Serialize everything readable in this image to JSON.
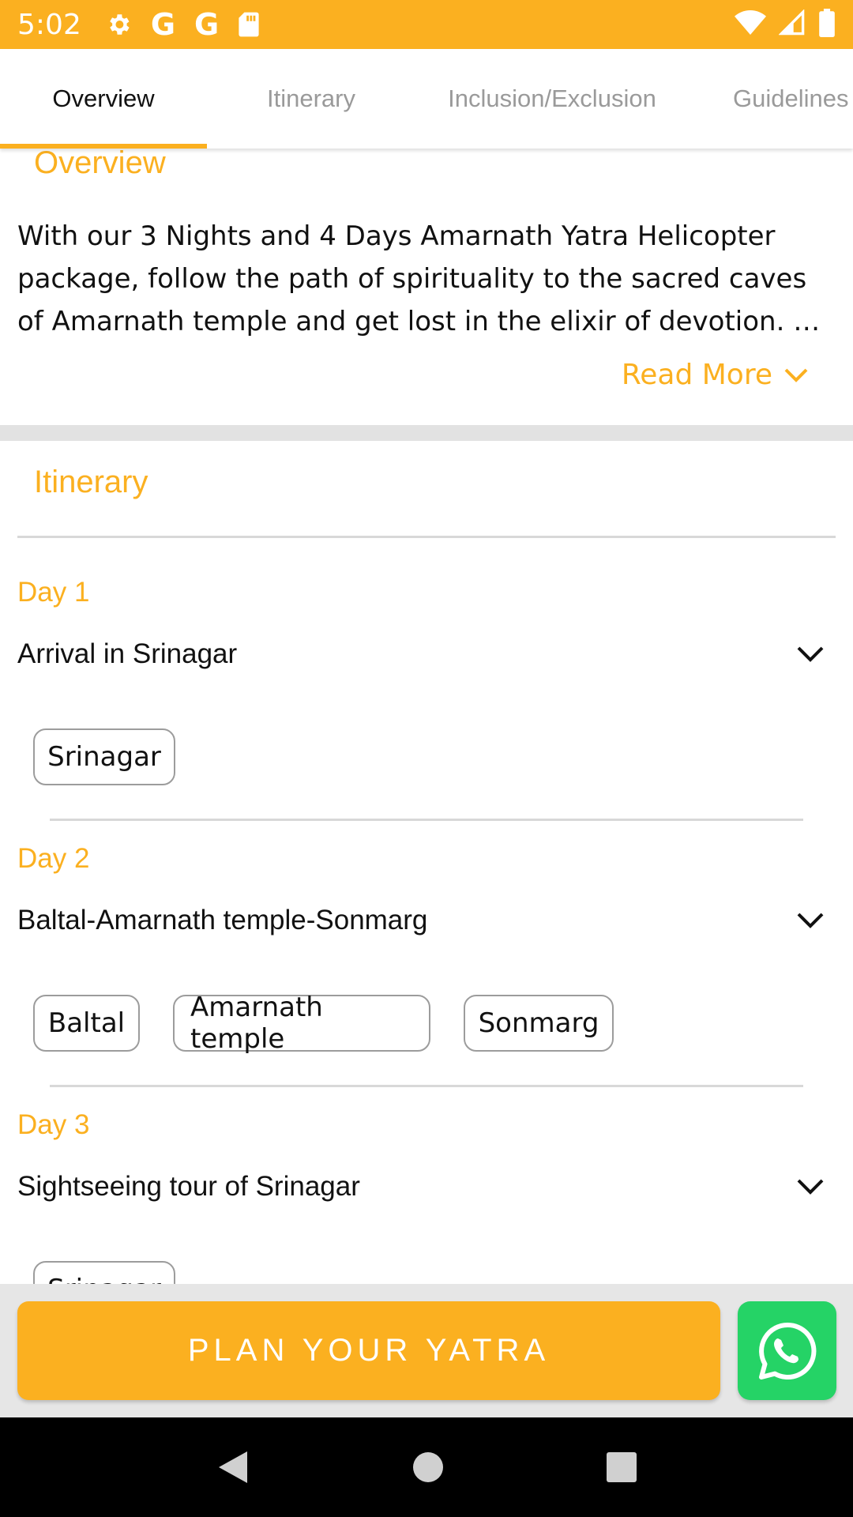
{
  "status_bar": {
    "time": "5:02",
    "left_icons": [
      "gear-icon",
      "google-g-icon",
      "google-g-icon",
      "sd-card-icon"
    ],
    "g_letter": "G",
    "right_icons": [
      "wifi-icon",
      "cellular-signal-icon",
      "battery-icon"
    ]
  },
  "tabs": [
    {
      "label": "Overview",
      "active": true
    },
    {
      "label": "Itinerary",
      "active": false
    },
    {
      "label": "Inclusion/Exclusion",
      "active": false
    },
    {
      "label": "Guidelines",
      "active": false
    }
  ],
  "overview": {
    "title": "Overview",
    "text": "With our 3 Nights and 4 Days Amarnath Yatra Helicopter package, follow the path of spirituality to the sacred caves of Amarnath temple and get lost in the elixir of devotion. …",
    "read_more": "Read More"
  },
  "itinerary": {
    "title": "Itinerary",
    "days": [
      {
        "label": "Day 1",
        "title": "Arrival in Srinagar",
        "places": [
          "Srinagar"
        ]
      },
      {
        "label": "Day 2",
        "title": "Baltal-Amarnath temple-Sonmarg",
        "places": [
          "Baltal",
          "Amarnath temple",
          "Sonmarg"
        ]
      },
      {
        "label": "Day 3",
        "title": "Sightseeing tour of Srinagar",
        "places": [
          "Srinagar"
        ]
      }
    ]
  },
  "actions": {
    "plan_button": "PLAN YOUR YATRA",
    "whatsapp_icon": "whatsapp-icon"
  },
  "nav_bar": {
    "icons": [
      "back-icon",
      "home-icon",
      "recents-icon"
    ]
  },
  "colors": {
    "accent": "#FBB020",
    "whatsapp": "#25D366",
    "text": "#111111",
    "muted": "#9a9a9a"
  }
}
